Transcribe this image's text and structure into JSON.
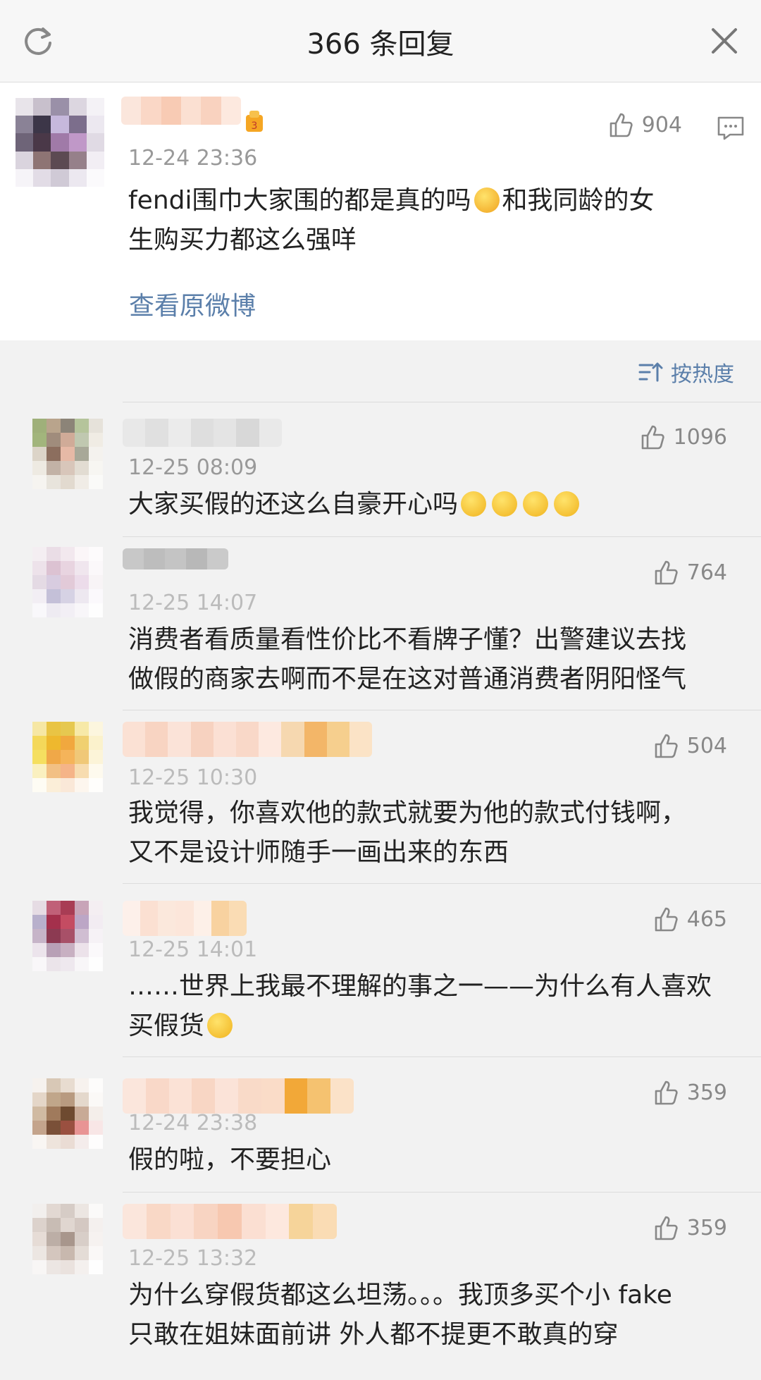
{
  "header": {
    "title": "366 条回复"
  },
  "main_post": {
    "time": "12-24 23:36",
    "text_line1": "fendi围巾大家围的都是真的吗",
    "text_line1b": "和我同龄的女",
    "text_line2": "生购买力都这么强咩",
    "likes": "904",
    "view_original": "查看原微博"
  },
  "sort": {
    "label": "按热度"
  },
  "comments": [
    {
      "time": "12-25 08:09",
      "likes": "1096",
      "lines": [
        "大家买假的还这么自豪开心吗"
      ]
    },
    {
      "time": "12-25 14:07",
      "likes": "764",
      "lines": [
        "消费者看质量看性价比不看牌子懂？出警建议去找",
        "做假的商家去啊而不是在这对普通消费者阴阳怪气"
      ]
    },
    {
      "time": "12-25 10:30",
      "likes": "504",
      "lines": [
        "我觉得，你喜欢他的款式就要为他的款式付钱啊，",
        "又不是设计师随手一画出来的东西"
      ]
    },
    {
      "time": "12-25 14:01",
      "likes": "465",
      "lines": [
        "……世界上我最不理解的事之一——为什么有人喜欢",
        "买假货"
      ]
    },
    {
      "time": "12-24 23:38",
      "likes": "359",
      "lines": [
        "假的啦，不要担心"
      ]
    },
    {
      "time": "12-25 13:32",
      "likes": "359",
      "lines": [
        "为什么穿假货都这么坦荡。。。我顶多买个小 fake",
        "只敢在姐妹面前讲 外人都不提更不敢真的穿"
      ]
    }
  ]
}
